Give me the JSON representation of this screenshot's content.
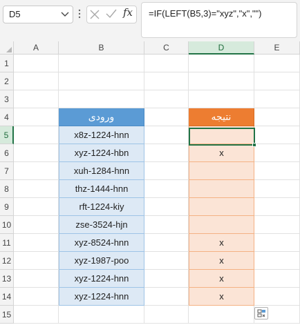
{
  "name_box": {
    "value": "D5",
    "chevron_icon": "chevron-down-icon"
  },
  "formula_bar": {
    "cancel_icon": "cancel-x-icon",
    "enter_icon": "enter-check-icon",
    "insert_function_label": "fx",
    "formula": "=IF(LEFT(B5,3)=\"xyz\",\"x\",\"\")"
  },
  "columns": [
    "A",
    "B",
    "C",
    "D",
    "E"
  ],
  "active_column": "D",
  "rows": [
    "1",
    "2",
    "3",
    "4",
    "5",
    "6",
    "7",
    "8",
    "9",
    "10",
    "11",
    "12",
    "13",
    "14",
    "15"
  ],
  "active_row": "5",
  "table": {
    "input_header": "ورودی",
    "result_header": "نتیجه",
    "input_values": [
      "x8z-1224-hnn",
      "xyz-1224-hbn",
      "xuh-1284-hnn",
      "thz-1444-hnn",
      "rft-1224-kiy",
      "zse-3524-hjn",
      "xyz-8524-hnn",
      "xyz-1987-poo",
      "xyz-1224-hnn",
      "xyz-1224-hnn"
    ],
    "result_values": [
      "",
      "x",
      "",
      "",
      "",
      "",
      "x",
      "x",
      "x",
      "x"
    ]
  },
  "colors": {
    "accent_green": "#217346",
    "input_header": "#5b9bd5",
    "result_header": "#ed7d31",
    "input_fill": "#dde9f5",
    "result_fill": "#fbe4d6"
  },
  "quick_analysis_icon": "quick-analysis-icon"
}
